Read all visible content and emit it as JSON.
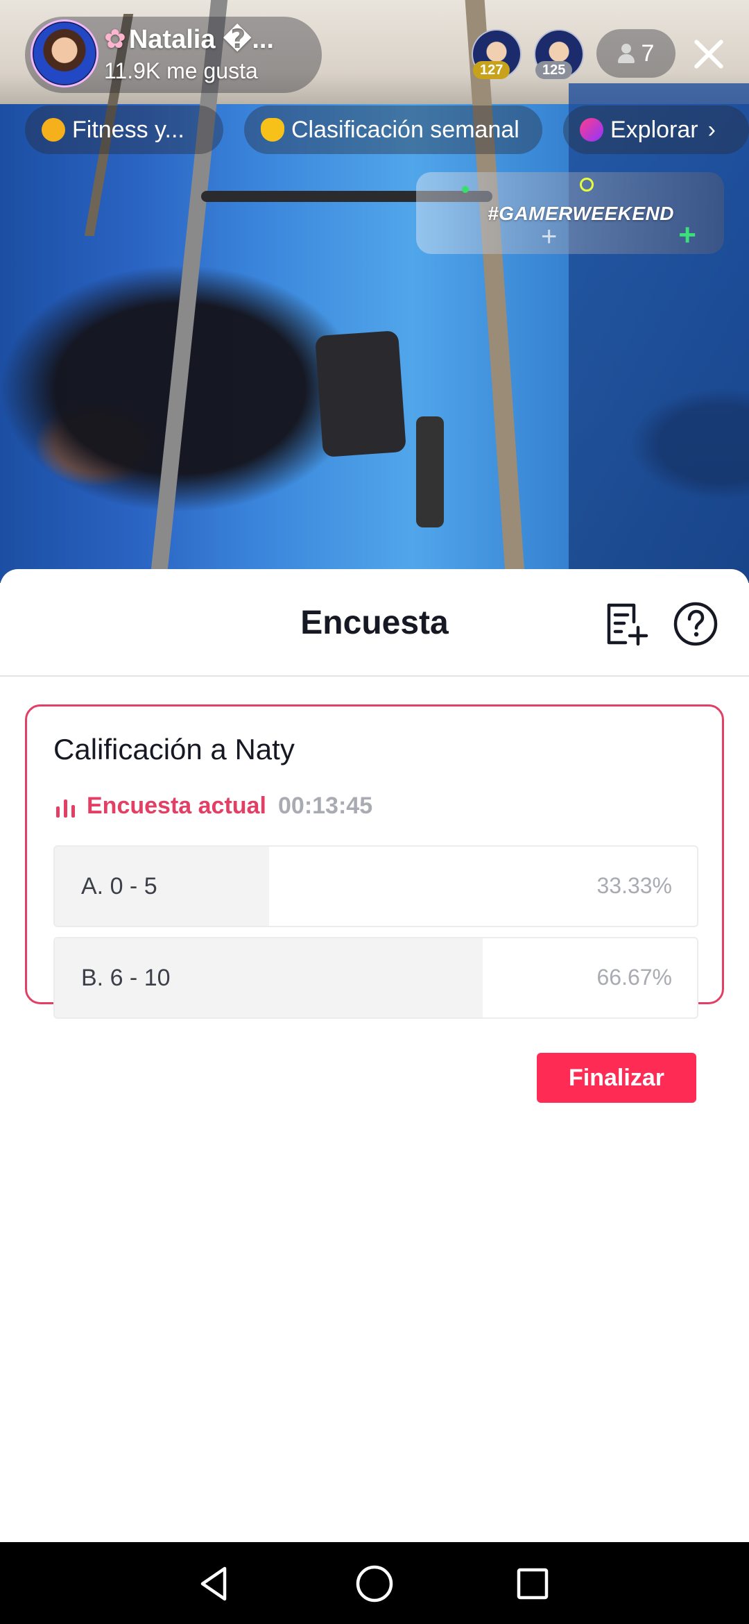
{
  "live": {
    "host_name": "Natalia �...",
    "host_likes": "11.9K me gusta",
    "viewers": [
      {
        "badge": "127"
      },
      {
        "badge": "125"
      }
    ],
    "viewer_count": "7",
    "chips": [
      {
        "label": "Fitness y..."
      },
      {
        "label": "Clasificación semanal"
      },
      {
        "label": "Explorar"
      }
    ],
    "event_tag": "#GAMERWEEKEND"
  },
  "sheet": {
    "title": "Encuesta",
    "poll": {
      "question": "Calificación a Naty",
      "status_label": "Encuesta actual",
      "timer": "00:13:45",
      "options": [
        {
          "label": "A. 0 - 5",
          "percent_text": "33.33%",
          "share": 0.3333
        },
        {
          "label": "B. 6 - 10",
          "percent_text": "66.67%",
          "share": 0.6667
        }
      ],
      "end_button_label": "Finalizar"
    }
  },
  "colors": {
    "accent": "#fe2c55",
    "card_border": "#e33f64",
    "muted_text": "#a9abb2"
  },
  "icons": [
    "close-icon",
    "person-icon",
    "poll-history-icon",
    "help-icon",
    "bar-chart-icon",
    "back-icon",
    "home-icon",
    "recents-icon"
  ]
}
